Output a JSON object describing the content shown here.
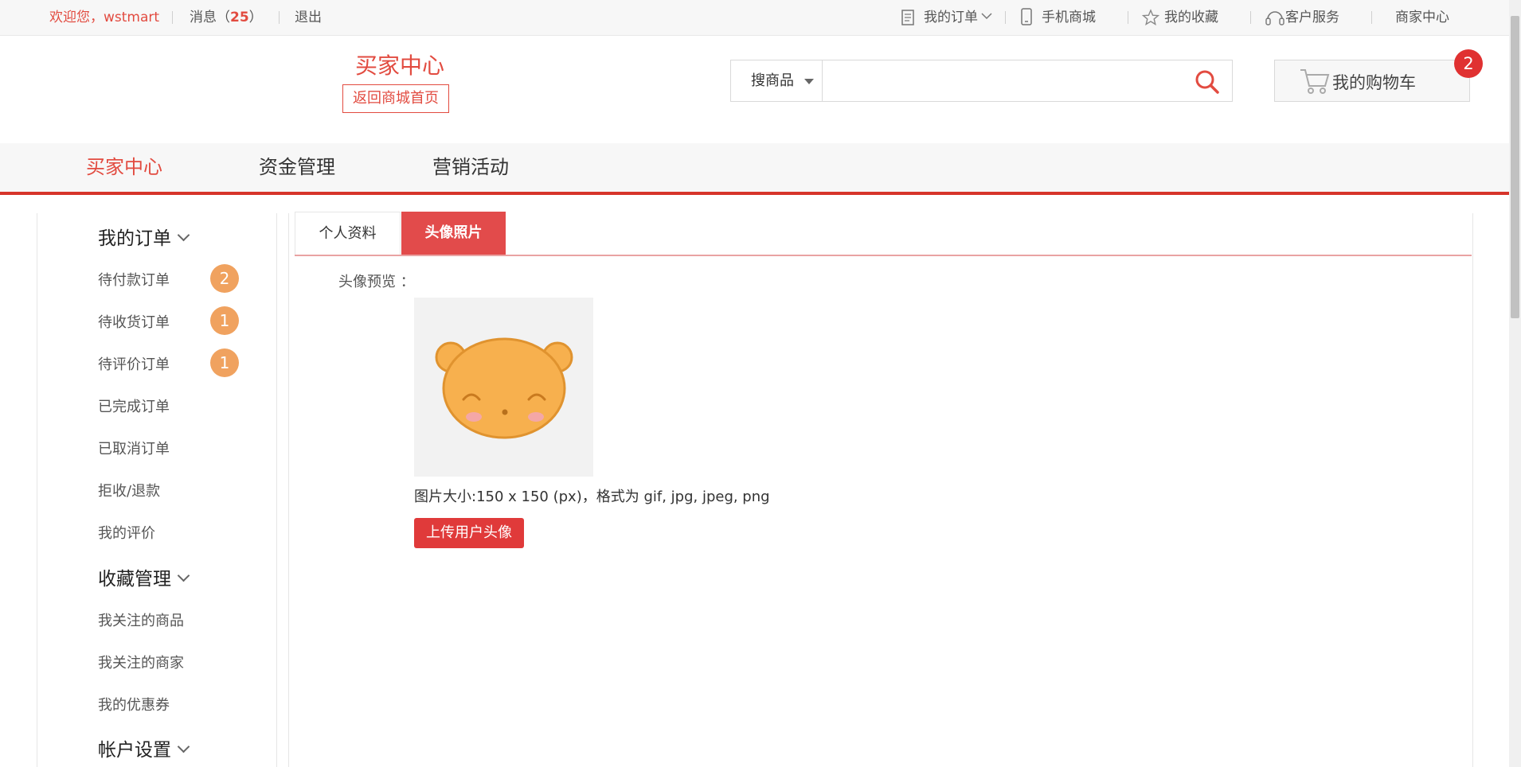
{
  "topbar": {
    "welcome": "欢迎您，",
    "username": "wstmart",
    "messages_label": "消息（",
    "messages_count": "25",
    "messages_close": "）",
    "logout": "退出",
    "my_orders": "我的订单",
    "mobile_mall": "手机商城",
    "my_favorites": "我的收藏",
    "customer_service": "客户服务",
    "merchant_center": "商家中心"
  },
  "header": {
    "title": "买家中心",
    "home_button": "返回商城首页",
    "search_type": "搜商品",
    "search_value": "",
    "cart_label": "我的购物车",
    "cart_count": "2"
  },
  "mainnav": [
    "买家中心",
    "资金管理",
    "营销活动"
  ],
  "sidebar": {
    "groups": [
      {
        "title": "我的订单",
        "items": [
          {
            "label": "待付款订单",
            "badge": "2"
          },
          {
            "label": "待收货订单",
            "badge": "1"
          },
          {
            "label": "待评价订单",
            "badge": "1"
          },
          {
            "label": "已完成订单"
          },
          {
            "label": "已取消订单"
          },
          {
            "label": "拒收/退款"
          },
          {
            "label": "我的评价"
          }
        ]
      },
      {
        "title": "收藏管理",
        "items": [
          {
            "label": "我关注的商品"
          },
          {
            "label": "我关注的商家"
          },
          {
            "label": "我的优惠券"
          }
        ]
      },
      {
        "title": "帐户设置",
        "items": []
      }
    ]
  },
  "content": {
    "tabs": [
      "个人资料",
      "头像照片"
    ],
    "active_tab": "头像照片",
    "preview_label": "头像预览 ：",
    "hint": "图片大小:150 x 150 (px)，格式为 gif, jpg, jpeg, png",
    "upload_button": "上传用户头像"
  },
  "colors": {
    "accent": "#e24b40",
    "badge_orange": "#f0a25f",
    "avatar_face": "#f7b04e"
  }
}
